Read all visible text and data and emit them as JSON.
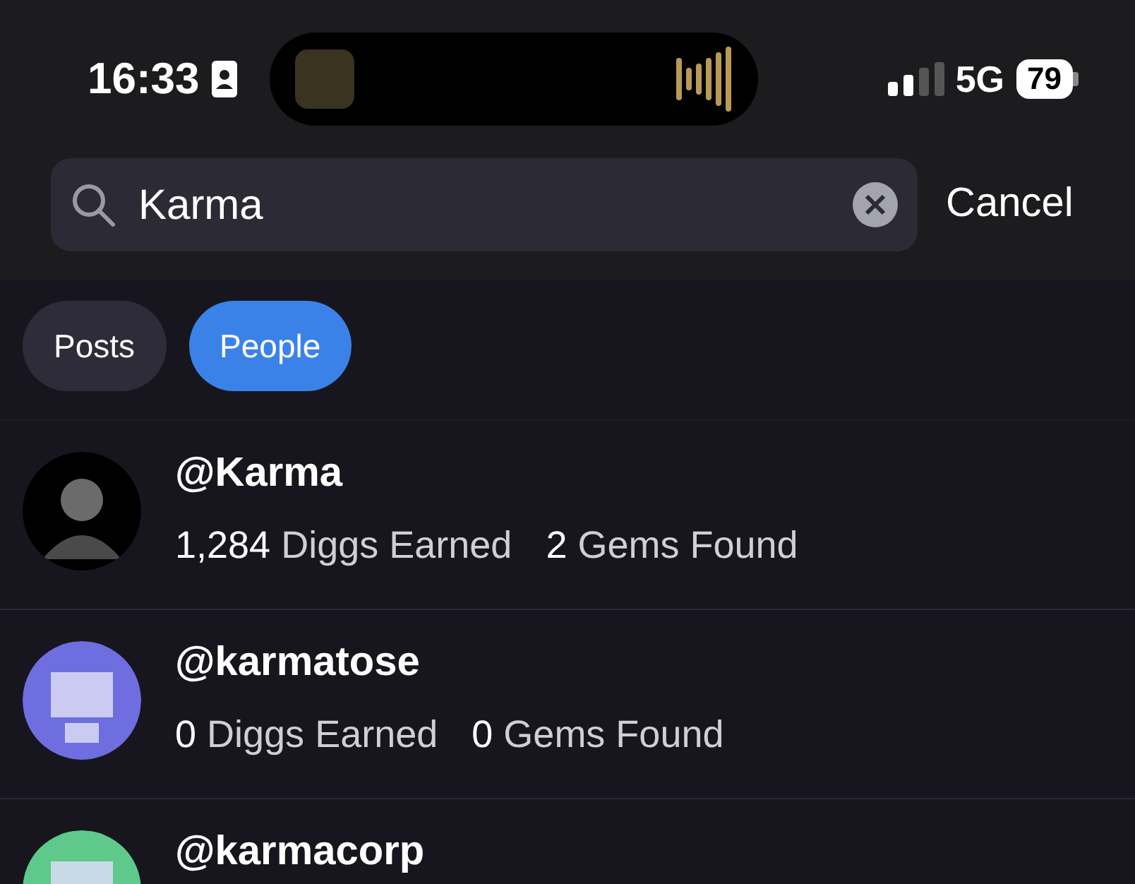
{
  "status_bar": {
    "time": "16:33",
    "network": "5G",
    "battery": "79"
  },
  "search": {
    "value": "Karma",
    "cancel": "Cancel"
  },
  "tabs": [
    {
      "label": "Posts",
      "selected": false
    },
    {
      "label": "People",
      "selected": true
    }
  ],
  "results": [
    {
      "handle": "@Karma",
      "avatar": {
        "kind": "photo",
        "color": "#000000"
      },
      "stats": [
        "**1,284** Diggs Earned",
        "**2** Gems Found"
      ]
    },
    {
      "handle": "@karmatose",
      "avatar": {
        "kind": "pixel",
        "color": "#6e6ee0"
      },
      "stats": [
        "**0** Diggs Earned",
        "**0** Gems Found"
      ]
    },
    {
      "handle": "@karmacorp",
      "avatar": {
        "kind": "pixel",
        "color": "#5ec98b"
      }
    }
  ]
}
